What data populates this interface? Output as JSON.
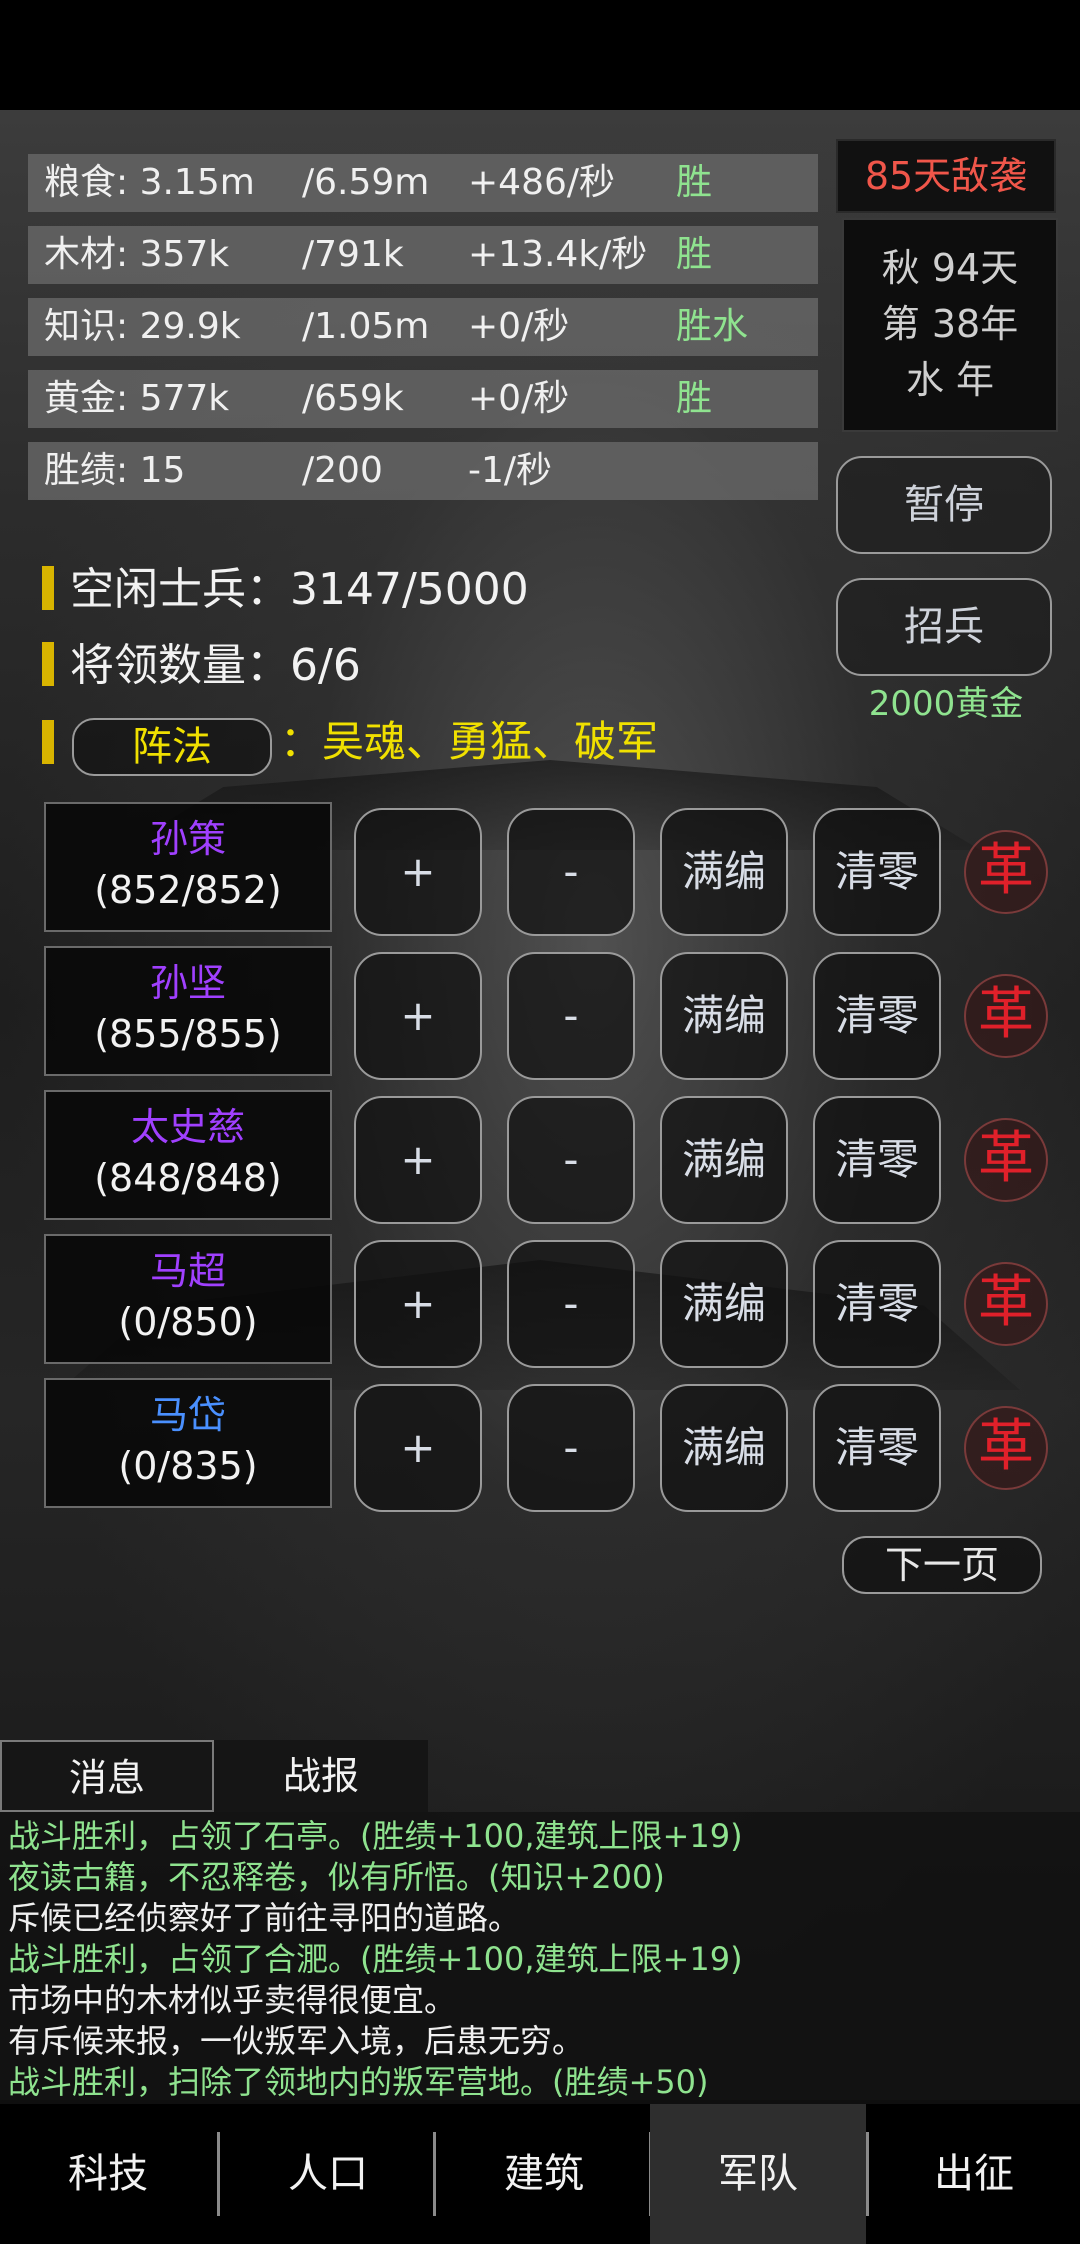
{
  "resources": [
    {
      "name": "粮食: 3.15m",
      "max": "/6.59m",
      "rate": "+486/秒",
      "flag": "胜"
    },
    {
      "name": "木材: 357k",
      "max": "/791k",
      "rate": "+13.4k/秒",
      "flag": "胜"
    },
    {
      "name": "知识: 29.9k",
      "max": "/1.05m",
      "rate": "+0/秒",
      "flag": "胜水"
    },
    {
      "name": "黄金: 577k",
      "max": "/659k",
      "rate": "+0/秒",
      "flag": "胜"
    },
    {
      "name": "胜绩: 15",
      "max": "/200",
      "rate": "-1/秒",
      "flag": ""
    }
  ],
  "raid": "85天敌袭",
  "date": {
    "line1": "秋 94天",
    "line2": "第 38年",
    "line3": "水 年"
  },
  "pause_label": "暂停",
  "recruit_label": "招兵",
  "recruit_cost": "2000黄金",
  "idle_soldiers": "空闲士兵：3147/5000",
  "general_count": "将领数量：6/6",
  "formation": {
    "button_label": "阵法",
    "text": "：吴魂、勇猛、破军"
  },
  "generals": [
    {
      "name": "孙策",
      "count": "(852/852)",
      "color": "#a040ff"
    },
    {
      "name": "孙坚",
      "count": "(855/855)",
      "color": "#a040ff"
    },
    {
      "name": "太史慈",
      "count": "(848/848)",
      "color": "#a040ff"
    },
    {
      "name": "马超",
      "count": "(0/850)",
      "color": "#a040ff"
    },
    {
      "name": "马岱",
      "count": "(0/835)",
      "color": "#4a90ff"
    }
  ],
  "row_buttons": {
    "plus": "+",
    "minus": "-",
    "fill": "满编",
    "clear": "清零",
    "reform": "革"
  },
  "next_page": "下一页",
  "log_tabs": [
    "消息",
    "战报"
  ],
  "log": [
    {
      "text": "战斗胜利，占领了石亭。(胜绩+100,建筑上限+19)",
      "color": "green"
    },
    {
      "text": "夜读古籍，不忍释卷，似有所悟。(知识+200)",
      "color": "green"
    },
    {
      "text": "斥候已经侦察好了前往寻阳的道路。",
      "color": "white"
    },
    {
      "text": "战斗胜利，占领了合淝。(胜绩+100,建筑上限+19)",
      "color": "green"
    },
    {
      "text": "市场中的木材似乎卖得很便宜。",
      "color": "white"
    },
    {
      "text": "有斥候来报，一伙叛军入境，后患无穷。",
      "color": "white"
    },
    {
      "text": "战斗胜利，扫除了领地内的叛军营地。(胜绩+50)",
      "color": "green"
    }
  ],
  "nav": [
    {
      "label": "科技",
      "active": false
    },
    {
      "label": "人口",
      "active": false
    },
    {
      "label": "建筑",
      "active": false
    },
    {
      "label": "军队",
      "active": true
    },
    {
      "label": "出征",
      "active": false
    }
  ]
}
